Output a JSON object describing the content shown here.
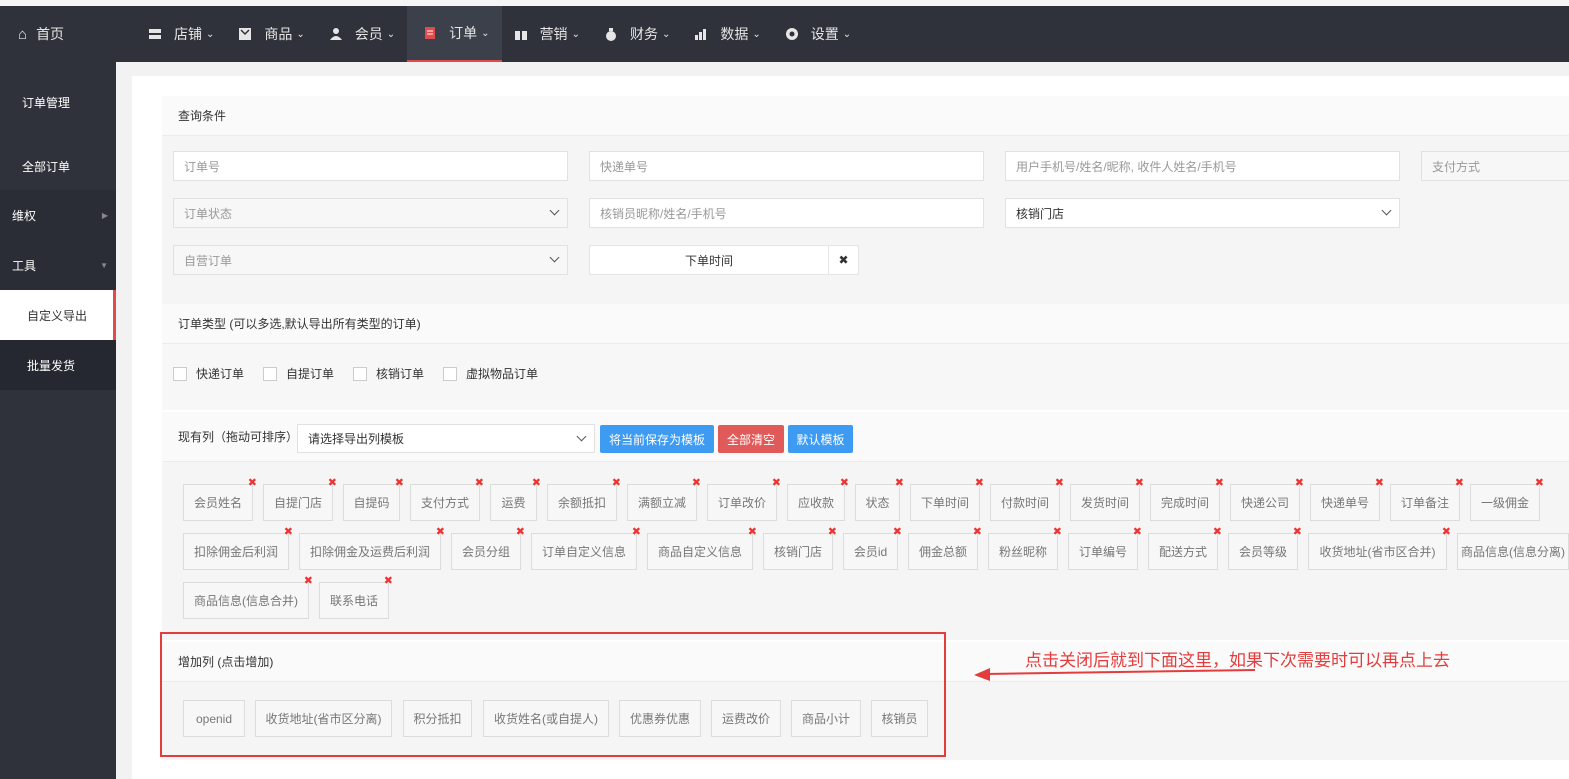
{
  "topnav": {
    "home": "首页",
    "items": [
      {
        "label": "店铺",
        "icon": "store-icon"
      },
      {
        "label": "商品",
        "icon": "goods-icon"
      },
      {
        "label": "会员",
        "icon": "member-icon"
      },
      {
        "label": "订单",
        "icon": "order-icon",
        "active": true
      },
      {
        "label": "营销",
        "icon": "gift-icon"
      },
      {
        "label": "财务",
        "icon": "money-bag-icon"
      },
      {
        "label": "数据",
        "icon": "chart-icon"
      },
      {
        "label": "设置",
        "icon": "gear-icon"
      }
    ]
  },
  "sidebar": {
    "items": [
      {
        "label": "订单管理"
      },
      {
        "label": "全部订单"
      },
      {
        "label": "维权"
      },
      {
        "label": "工具"
      },
      {
        "label": "自定义导出"
      },
      {
        "label": "批量发货"
      }
    ]
  },
  "query": {
    "title": "查询条件",
    "order_no": "订单号",
    "express_no": "快递单号",
    "user": "用户手机号/姓名/昵称, 收件人姓名/手机号",
    "pay_method": "支付方式",
    "order_status": "订单状态",
    "verifier": "核销员昵称/姓名/手机号",
    "store": "核销门店",
    "self_order": "自营订单",
    "order_time": "下单时间"
  },
  "order_type": {
    "title": "订单类型 (可以多选,默认导出所有类型的订单)",
    "options": [
      "快递订单",
      "自提订单",
      "核销订单",
      "虚拟物品订单"
    ]
  },
  "columns": {
    "title": "现有列（拖动可排序）",
    "template_select": "请选择导出列模板",
    "save_template": "将当前保存为模板",
    "clear_all": "全部清空",
    "default_template": "默认模板",
    "row1": [
      "会员姓名",
      "自提门店",
      "自提码",
      "支付方式",
      "运费",
      "余额抵扣",
      "满额立减",
      "订单改价",
      "应收款",
      "状态",
      "下单时间",
      "付款时间",
      "发货时间",
      "完成时间",
      "快递公司",
      "快递单号",
      "订单备注",
      "一级佣金"
    ],
    "row2": [
      "扣除佣金后利润",
      "扣除佣金及运费后利润",
      "会员分组",
      "订单自定义信息",
      "商品自定义信息",
      "核销门店",
      "会员id",
      "佣金总额",
      "粉丝昵称",
      "订单编号",
      "配送方式",
      "会员等级",
      "收货地址(省市区合并)",
      "商品信息(信息分离)"
    ],
    "row3": [
      "商品信息(信息合并)",
      "联系电话"
    ],
    "close_mark": "✖"
  },
  "add_columns": {
    "title": "增加列 (点击增加)",
    "items": [
      "openid",
      "收货地址(省市区分离)",
      "积分抵扣",
      "收货姓名(或自提人)",
      "优惠券优惠",
      "运费改价",
      "商品小计",
      "核销员"
    ]
  },
  "annotation": "点击关闭后就到下面这里，如果下次需要时可以再点上去",
  "colors": {
    "accent": "#e43c3c",
    "blue": "#3e9bf2",
    "red_btn": "#e05a5a",
    "nav_bg": "#2f323a"
  }
}
